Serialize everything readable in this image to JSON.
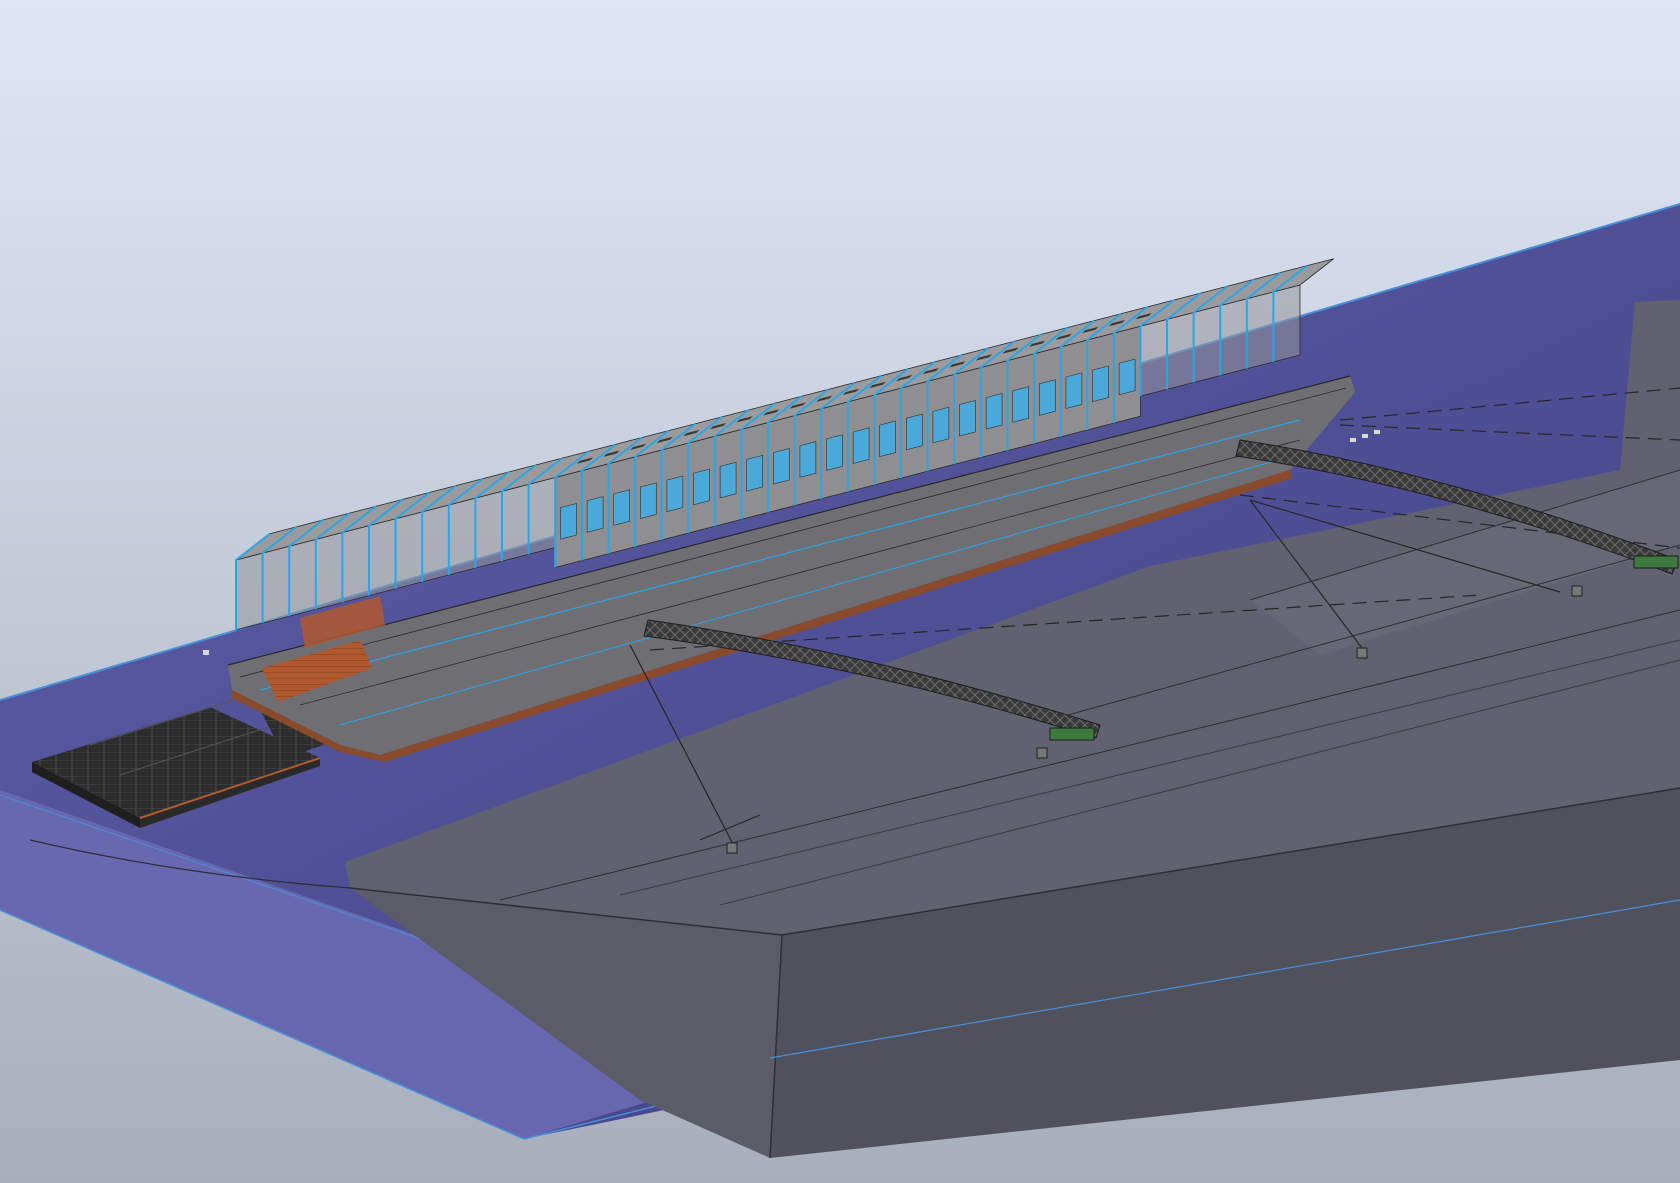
{
  "viewport": {
    "background_top": "#dfe7f7",
    "background_bottom": "#a8b1bd"
  },
  "colors": {
    "water_plane": "#5a5aa6",
    "water_plane_dark": "#3a3a7a",
    "water_edge": "#4a8fd9",
    "ground_top": "#5f6170",
    "ground_side": "#4d4f5b",
    "hull": "#6e6e72",
    "module_fill": "#9b9b9d",
    "frame_blue": "#2aa6e8",
    "deck_wood": "#b0582e",
    "gangway": "#3c3c3c",
    "mooring_line": "#262626"
  },
  "icons": {
    "hull_markings": "label-marks",
    "bow_marking": "label-marks"
  }
}
